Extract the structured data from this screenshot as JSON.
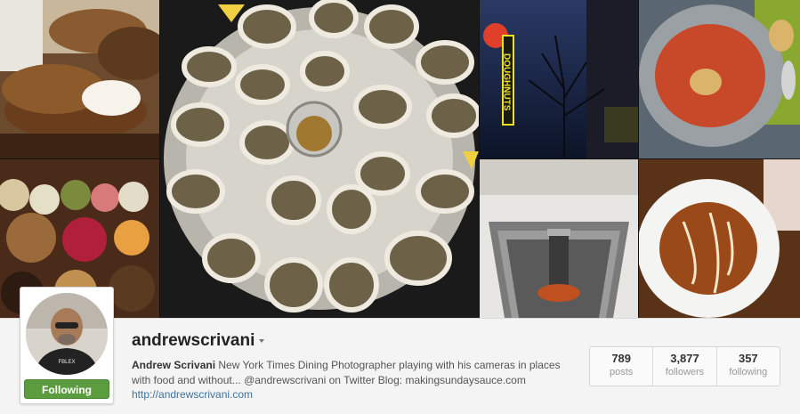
{
  "profile": {
    "username": "andrewscrivani",
    "full_name": "Andrew Scrivani",
    "bio": "New York Times Dining Photographer playing with his cameras in places with food and without... @andrewscrivani on Twitter Blog: makingsundaysauce.com",
    "website": "http://andrewscrivani.com",
    "follow_button": "Following",
    "avatar_shirt_text": "FBLEX"
  },
  "stats": [
    {
      "value": "789",
      "label": "posts"
    },
    {
      "value": "3,877",
      "label": "followers"
    },
    {
      "value": "357",
      "label": "following"
    }
  ],
  "mosaic_sign_text": "DOUGHNUTS",
  "colors": {
    "follow_green": "#5b9c3f",
    "link_blue": "#3f729b",
    "neon_yellow": "#f0e020",
    "soup_orange": "#c8482a"
  }
}
